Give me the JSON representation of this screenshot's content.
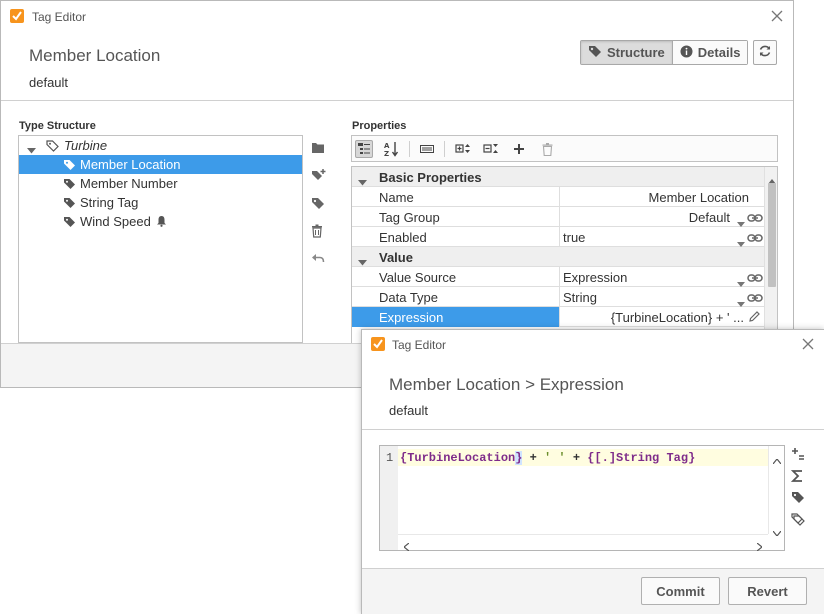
{
  "main_window": {
    "title": "Tag Editor",
    "header_title": "Member Location",
    "header_sub": "default",
    "toggle": {
      "structure": "Structure",
      "details": "Details"
    },
    "type_structure_label": "Type Structure",
    "properties_label": "Properties",
    "tree": [
      {
        "label": "Turbine"
      },
      {
        "label": "Member Location"
      },
      {
        "label": "Member Number"
      },
      {
        "label": "String Tag"
      },
      {
        "label": "Wind Speed"
      }
    ],
    "properties": {
      "cat_basic": "Basic Properties",
      "cat_value": "Value",
      "rows": [
        {
          "name": "Name",
          "value": "Member Location"
        },
        {
          "name": "Tag Group",
          "value": "Default"
        },
        {
          "name": "Enabled",
          "value": "true"
        },
        {
          "name": "Value Source",
          "value": "Expression"
        },
        {
          "name": "Data Type",
          "value": "String"
        },
        {
          "name": "Expression",
          "value": "{TurbineLocation} + ' ..."
        }
      ]
    }
  },
  "expression_window": {
    "title": "Tag Editor",
    "header_title": "Member Location > Expression",
    "header_sub": "default",
    "line_number": "1",
    "code": {
      "ref": "{TurbineLocation",
      "brace": "}",
      "op1": " + ",
      "str": "' '",
      "op2": " + ",
      "path": "{[.]String Tag}"
    },
    "commit": "Commit",
    "revert": "Revert"
  },
  "colors": {
    "selection": "#3d9be9",
    "app_icon": "#f7941d"
  }
}
